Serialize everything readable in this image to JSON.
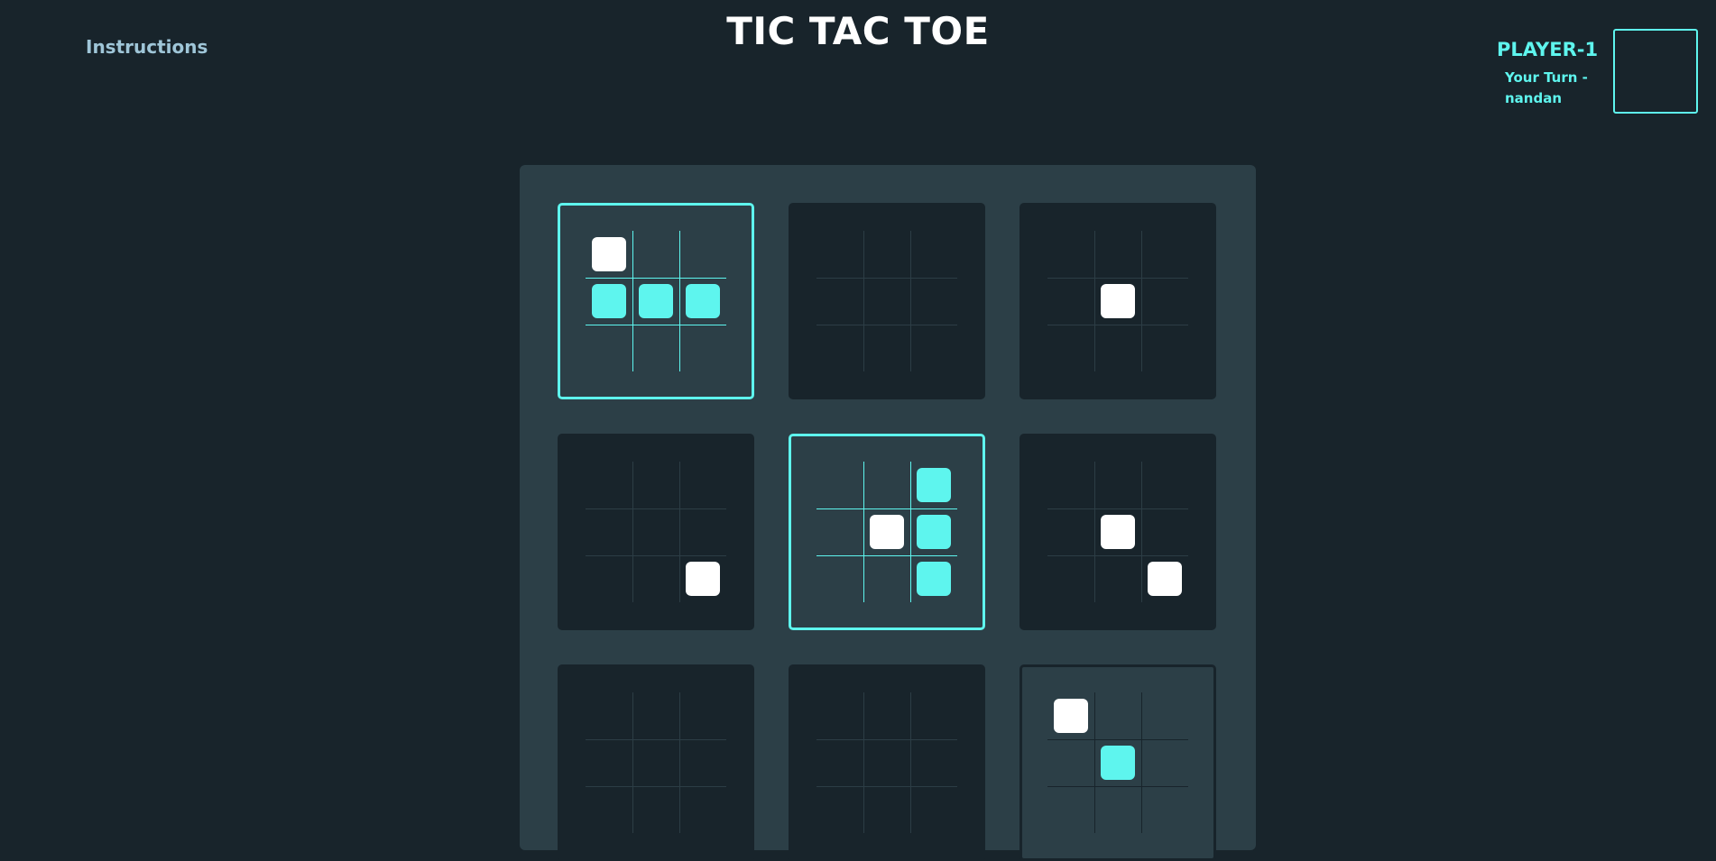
{
  "header": {
    "instructions_label": "Instructions",
    "title": "TIC TAC TOE"
  },
  "player": {
    "name": "PLAYER-1",
    "turn_text": "Your Turn - nandan"
  },
  "colors": {
    "accent": "#5ef5ee",
    "player_o": "#ffffff",
    "background": "#18242b",
    "board": "#2c3f47"
  },
  "board": {
    "boards": [
      {
        "state": "active",
        "cells": [
          "O",
          "",
          "",
          "X",
          "X",
          "X",
          "",
          "",
          ""
        ]
      },
      {
        "state": "normal",
        "cells": [
          "",
          "",
          "",
          "",
          "",
          "",
          "",
          "",
          ""
        ]
      },
      {
        "state": "normal",
        "cells": [
          "",
          "",
          "",
          "",
          "O",
          "",
          "",
          "",
          ""
        ]
      },
      {
        "state": "normal",
        "cells": [
          "",
          "",
          "",
          "",
          "",
          "",
          "",
          "",
          "O"
        ]
      },
      {
        "state": "active",
        "cells": [
          "",
          "",
          "X",
          "",
          "O",
          "X",
          "",
          "",
          "X"
        ]
      },
      {
        "state": "normal",
        "cells": [
          "",
          "",
          "",
          "",
          "O",
          "",
          "",
          "",
          "O"
        ]
      },
      {
        "state": "normal",
        "cells": [
          "",
          "",
          "",
          "",
          "",
          "",
          "",
          "",
          ""
        ]
      },
      {
        "state": "normal",
        "cells": [
          "",
          "",
          "",
          "",
          "",
          "",
          "",
          "",
          ""
        ]
      },
      {
        "state": "last",
        "cells": [
          "O",
          "",
          "",
          "",
          "X",
          "",
          "",
          "",
          ""
        ]
      }
    ]
  }
}
